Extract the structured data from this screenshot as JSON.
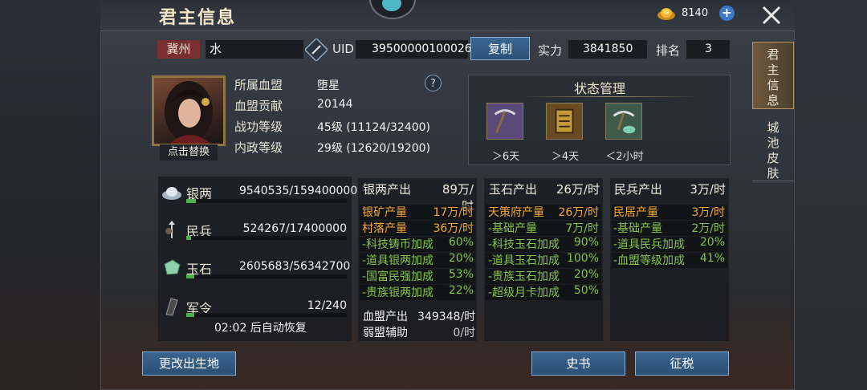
{
  "title": "君主信息",
  "gold": "8140",
  "server": "冀州",
  "name": "水",
  "uid_label": "UID",
  "uid": "39500000100026",
  "copy_label": "复制",
  "power_label": "实力",
  "power": "3841850",
  "rank_label": "排名",
  "rank": "3",
  "side_tabs": [
    "君主信息",
    "城池皮肤"
  ],
  "portrait_button": "点击替换",
  "info": [
    {
      "label": "所属血盟",
      "value": "堕星"
    },
    {
      "label": "血盟贡献",
      "value": "20144"
    },
    {
      "label": "战功等级",
      "value": "45级 (11124/32400)"
    },
    {
      "label": "内政等级",
      "value": "29级 (12620/19200)"
    }
  ],
  "status": {
    "title": "状态管理",
    "items": [
      {
        "icon": "pickaxe-icon",
        "text": "＞6天"
      },
      {
        "icon": "scroll-icon",
        "text": "＞4天"
      },
      {
        "icon": "jade-pickaxe-icon",
        "text": "＜2小时"
      }
    ]
  },
  "resources": [
    {
      "icon": "silver-icon",
      "name": "银两",
      "value": "9540535/159400000",
      "fill": 0.06
    },
    {
      "icon": "militia-icon",
      "name": "民兵",
      "value": "524267/17400000",
      "fill": 0.03
    },
    {
      "icon": "jade-icon",
      "name": "玉石",
      "value": "2605683/56342700",
      "fill": 0.05
    },
    {
      "icon": "military-order-icon",
      "name": "军令",
      "value": "12/240",
      "fill": 0.05
    }
  ],
  "recover_text": "02:02 后自动恢复",
  "silver_col": {
    "header_name": "银两产出",
    "header_value": "89万/时",
    "rows": [
      {
        "name": "银矿产量",
        "value": "17万/时",
        "color": "orange"
      },
      {
        "name": "村落产量",
        "value": "36万/时",
        "color": "orange"
      },
      {
        "name": "-科技铸币加成",
        "value": "60%",
        "color": "green"
      },
      {
        "name": "-道具银两加成",
        "value": "20%",
        "color": "green"
      },
      {
        "name": "-国富民强加成",
        "value": "53%",
        "color": "green"
      },
      {
        "name": "-贵族银两加成",
        "value": "22%",
        "color": "green"
      }
    ],
    "extra": [
      {
        "name": "血盟产出",
        "value": "349348/时"
      },
      {
        "name": "弱盟辅助",
        "value": "0/时"
      }
    ]
  },
  "jade_col": {
    "header_name": "玉石产出",
    "header_value": "26万/时",
    "rows": [
      {
        "name": "天策府产量",
        "value": "26万/时",
        "color": "orange"
      },
      {
        "name": "-基础产量",
        "value": "7万/时",
        "color": "green"
      },
      {
        "name": "-科技玉石加成",
        "value": "90%",
        "color": "green"
      },
      {
        "name": "-道具玉石加成",
        "value": "100%",
        "color": "green"
      },
      {
        "name": "-贵族玉石加成",
        "value": "20%",
        "color": "green"
      },
      {
        "name": "-超级月卡加成",
        "value": "50%",
        "color": "green"
      }
    ]
  },
  "militia_col": {
    "header_name": "民兵产出",
    "header_value": "3万/时",
    "rows": [
      {
        "name": "民居产量",
        "value": "3万/时",
        "color": "orange"
      },
      {
        "name": "-基础产量",
        "value": "2万/时",
        "color": "green"
      },
      {
        "name": "-道具民兵加成",
        "value": "20%",
        "color": "green"
      },
      {
        "name": "-血盟等级加成",
        "value": "41%",
        "color": "green"
      }
    ]
  },
  "buttons": {
    "change_birthplace": "更改出生地",
    "history": "史书",
    "tax": "征税"
  }
}
